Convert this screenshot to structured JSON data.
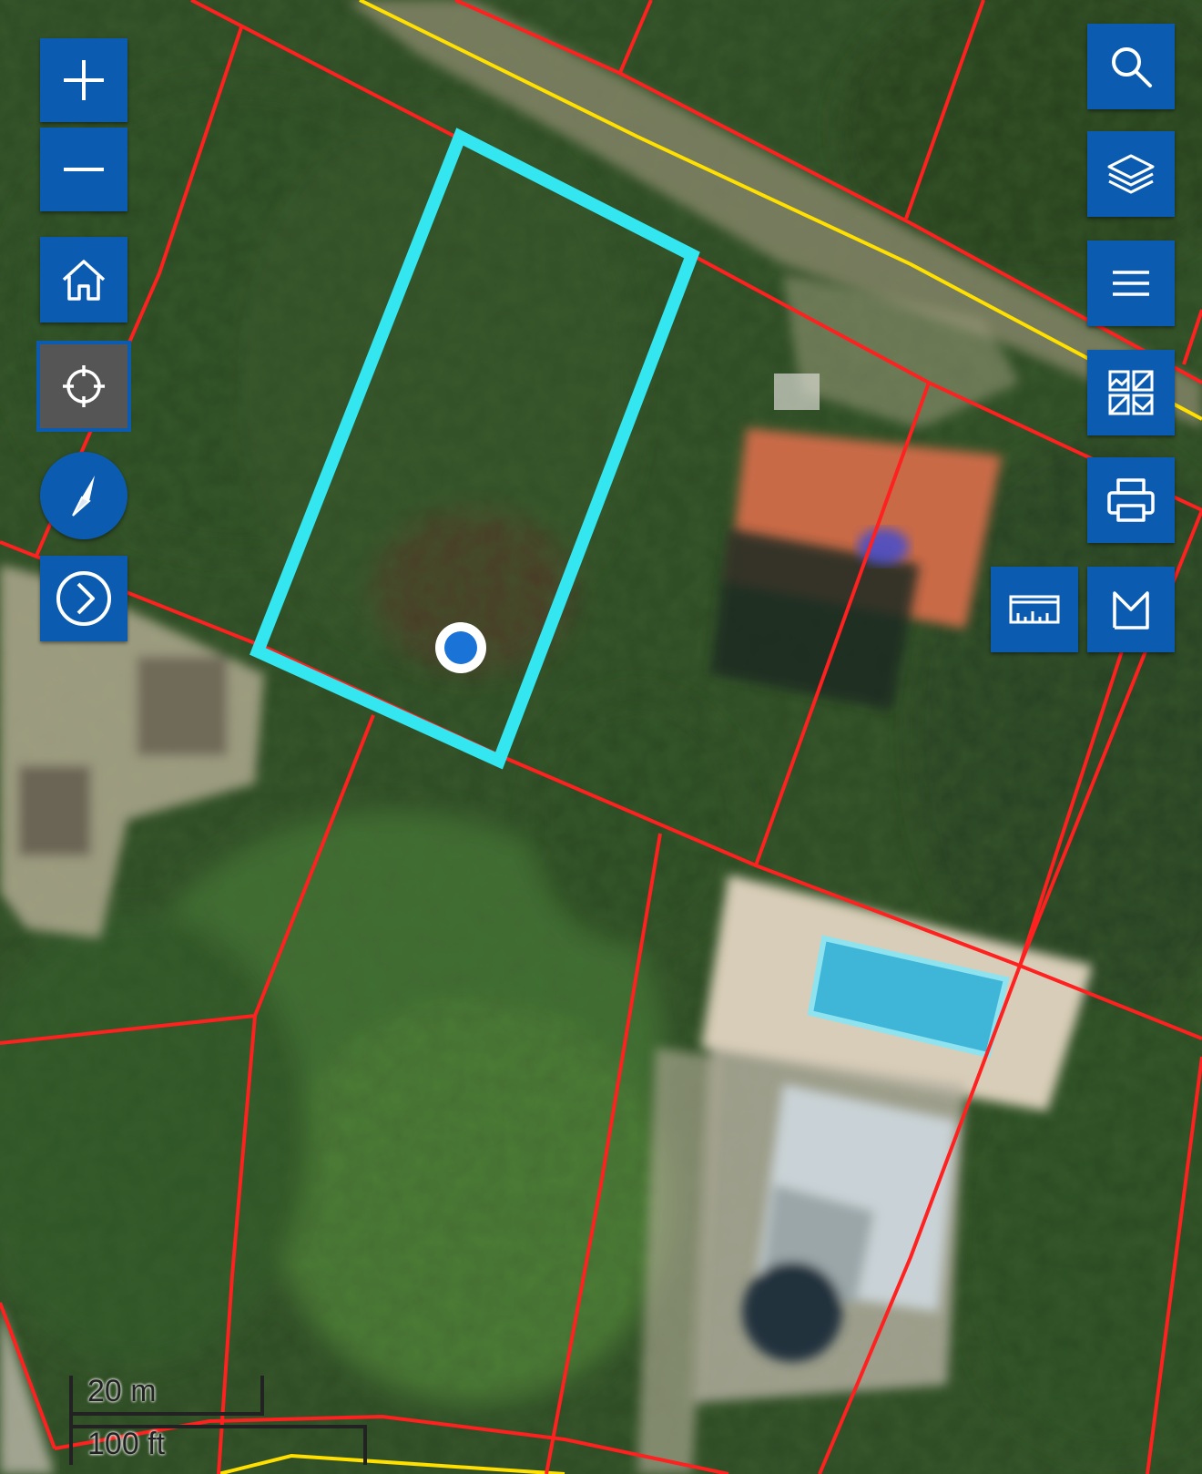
{
  "map": {
    "basemap": "satellite-imagery",
    "parcel_line_color": "#ff2020",
    "road_centerline_color": "#ffe000",
    "selected_parcel_color": "#33e6f0",
    "location_marker_color": "#1a73d6"
  },
  "controls": {
    "accent_color": "#0b5cb0",
    "left": [
      {
        "name": "zoom-in-button",
        "icon": "plus-icon"
      },
      {
        "name": "zoom-out-button",
        "icon": "minus-icon"
      },
      {
        "name": "home-button",
        "icon": "home-icon"
      },
      {
        "name": "locate-button",
        "icon": "crosshair-icon",
        "active": true
      },
      {
        "name": "compass-button",
        "icon": "compass-icon"
      },
      {
        "name": "expand-button",
        "icon": "chevron-right-circle-icon"
      }
    ],
    "right": [
      {
        "name": "search-button",
        "icon": "search-icon"
      },
      {
        "name": "layers-button",
        "icon": "layers-icon"
      },
      {
        "name": "menu-button",
        "icon": "menu-icon"
      },
      {
        "name": "basemap-gallery-button",
        "icon": "basemap-gallery-icon"
      },
      {
        "name": "print-button",
        "icon": "printer-icon"
      },
      {
        "name": "measure-button",
        "icon": "ruler-icon"
      },
      {
        "name": "bookmark-button",
        "icon": "bookmark-icon"
      }
    ]
  },
  "scale": {
    "metric_label": "20 m",
    "imperial_label": "100 ft"
  }
}
